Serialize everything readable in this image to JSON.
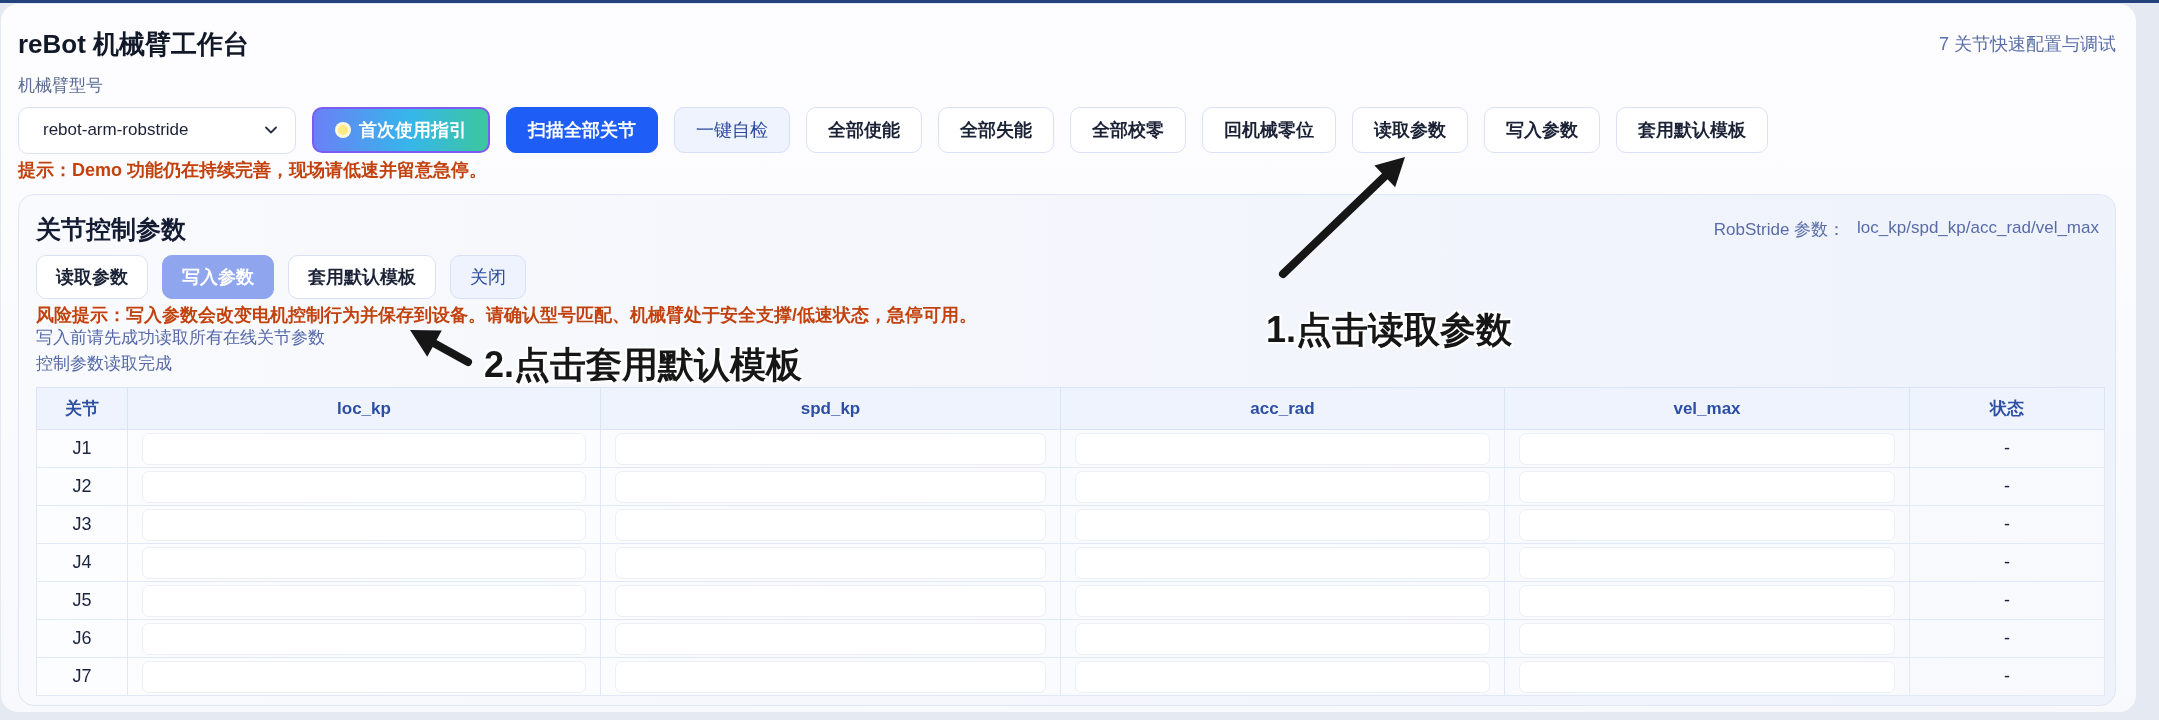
{
  "header": {
    "title": "reBot 机械臂工作台",
    "subtitle": "7 关节快速配置与调试"
  },
  "model": {
    "label": "机械臂型号",
    "value": "rebot-arm-robstride"
  },
  "toolbar": [
    {
      "label": "首次使用指引",
      "kind": "guide"
    },
    {
      "label": "扫描全部关节",
      "kind": "primary"
    },
    {
      "label": "一键自检",
      "kind": "soft"
    },
    {
      "label": "全部使能",
      "kind": "plain"
    },
    {
      "label": "全部失能",
      "kind": "plain"
    },
    {
      "label": "全部校零",
      "kind": "plain"
    },
    {
      "label": "回机械零位",
      "kind": "plain"
    },
    {
      "label": "读取参数",
      "kind": "plain"
    },
    {
      "label": "写入参数",
      "kind": "plain"
    },
    {
      "label": "套用默认模板",
      "kind": "plain"
    }
  ],
  "notice": "提示：Demo 功能仍在持续完善，现场请低速并留意急停。",
  "panel": {
    "title": "关节控制参数",
    "info": {
      "label": "RobStride 参数：",
      "value": "loc_kp/spd_kp/acc_rad/vel_max"
    },
    "buttons": [
      {
        "label": "读取参数",
        "kind": "plain",
        "disabled": false
      },
      {
        "label": "写入参数",
        "kind": "primary",
        "disabled": true
      },
      {
        "label": "套用默认模板",
        "kind": "plain",
        "disabled": false
      },
      {
        "label": "关闭",
        "kind": "soft",
        "disabled": false
      }
    ],
    "warning": "风险提示：写入参数会改变电机控制行为并保存到设备。请确认型号匹配、机械臂处于安全支撑/低速状态，急停可用。",
    "messages": [
      "写入前请先成功读取所有在线关节参数",
      "控制参数读取完成"
    ],
    "table": {
      "columns": [
        {
          "title": "关节",
          "kind": "joint"
        },
        {
          "title": "loc_kp",
          "kind": "param"
        },
        {
          "title": "spd_kp",
          "kind": "param"
        },
        {
          "title": "acc_rad",
          "kind": "param"
        },
        {
          "title": "vel_max",
          "kind": "param"
        },
        {
          "title": "状态",
          "kind": "status"
        }
      ],
      "rows": [
        {
          "joint": "J1",
          "status": "-"
        },
        {
          "joint": "J2",
          "status": "-"
        },
        {
          "joint": "J3",
          "status": "-"
        },
        {
          "joint": "J4",
          "status": "-"
        },
        {
          "joint": "J5",
          "status": "-"
        },
        {
          "joint": "J6",
          "status": "-"
        },
        {
          "joint": "J7",
          "status": "-"
        }
      ]
    }
  },
  "annotations": [
    {
      "text": "1.点击读取参数"
    },
    {
      "text": "2.点击套用默认模板"
    }
  ]
}
